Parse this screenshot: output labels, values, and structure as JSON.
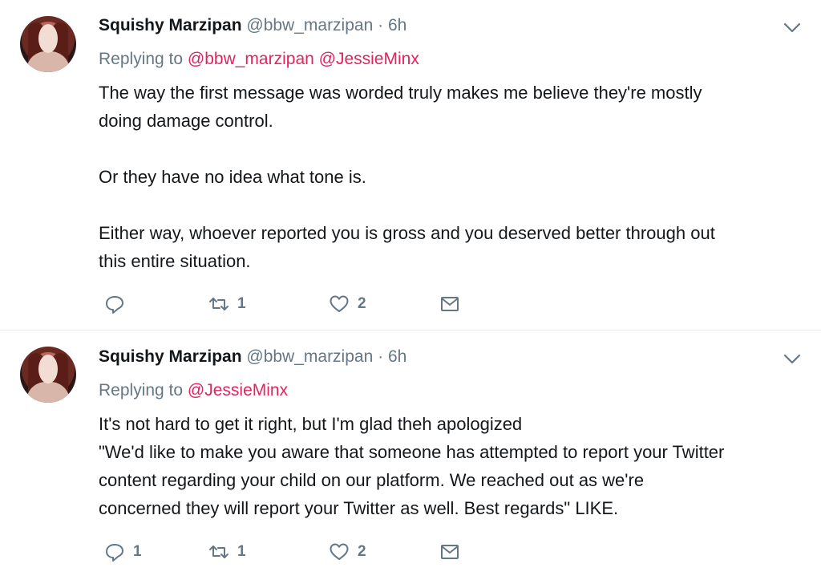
{
  "tweets": [
    {
      "author_name": "Squishy Marzipan",
      "handle": "@bbw_marzipan",
      "separator": "·",
      "time": "6h",
      "replying_prefix": "Replying to",
      "replying_to": [
        "@bbw_marzipan",
        "@JessieMinx"
      ],
      "body_lines": [
        "The way the first message was worded truly makes me believe they're mostly",
        "doing damage control.",
        "",
        "Or they have no idea what tone is.",
        "",
        "Either way, whoever reported you is gross and you deserved better through out",
        "this entire situation."
      ],
      "reply_count": "",
      "retweet_count": "1",
      "like_count": "2"
    },
    {
      "author_name": "Squishy Marzipan",
      "handle": "@bbw_marzipan",
      "separator": "·",
      "time": "6h",
      "replying_prefix": "Replying to",
      "replying_to": [
        "@JessieMinx"
      ],
      "body_lines": [
        "It's not hard to get it right, but I'm glad theh apologized",
        "\"We'd like to make you aware that someone has attempted to report your Twitter",
        "content regarding your child on our platform. We reached out as we're",
        "concerned they will report your Twitter as well. Best regards\" LIKE."
      ],
      "reply_count": "1",
      "retweet_count": "1",
      "like_count": "2"
    }
  ],
  "icons": {
    "reply": "reply-icon",
    "retweet": "retweet-icon",
    "like": "heart-icon",
    "dm": "envelope-icon",
    "more": "chevron-down-icon"
  },
  "colors": {
    "mention": "#e0245e",
    "secondary_text": "#657786",
    "primary_text": "#14171a",
    "divider": "#e6ecf0"
  }
}
